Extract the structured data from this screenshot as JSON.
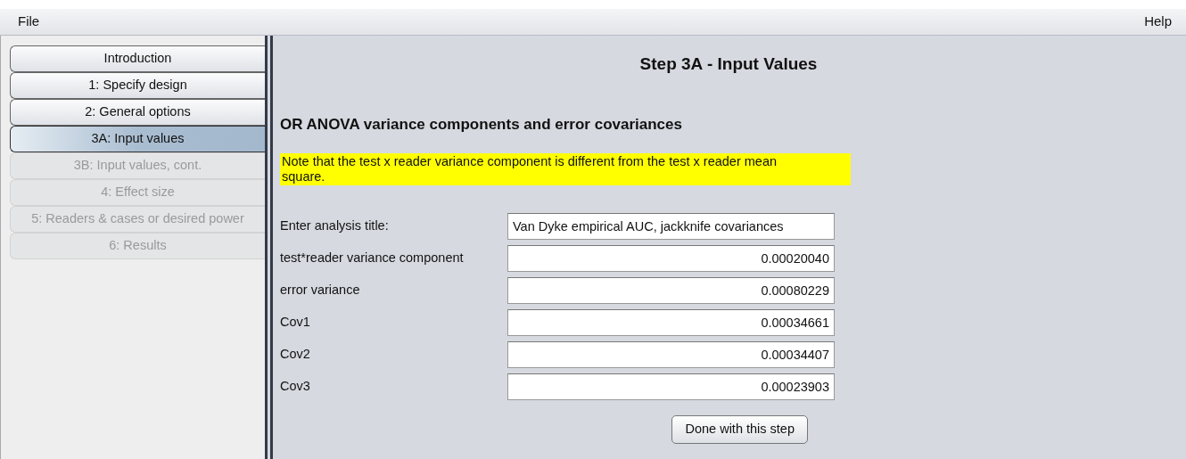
{
  "menu": [
    {
      "label": "File"
    },
    {
      "label": "Help"
    }
  ],
  "steps": [
    {
      "label": "Introduction",
      "selected": false,
      "disabled": false
    },
    {
      "label": "1: Specify design",
      "selected": false,
      "disabled": false
    },
    {
      "label": "2: General options",
      "selected": false,
      "disabled": false
    },
    {
      "label": "3A: Input values",
      "selected": true,
      "disabled": false
    },
    {
      "label": "3B: Input values, cont.",
      "selected": false,
      "disabled": true
    },
    {
      "label": "4: Effect size",
      "selected": false,
      "disabled": true
    },
    {
      "label": "5: Readers & cases or desired power",
      "selected": false,
      "disabled": true
    },
    {
      "label": "6: Results",
      "selected": false,
      "disabled": true
    }
  ],
  "title": "Step 3A - Input Values",
  "section_heading": "OR ANOVA variance components and error covariances",
  "note": "Note that the test x reader variance component is different from the test x reader mean square.",
  "fields": [
    {
      "label": "Enter analysis title:",
      "value": "Van Dyke empirical AUC, jackknife covariances",
      "kind": "text"
    },
    {
      "label": "test*reader variance component",
      "value": "0.00020040",
      "kind": "number"
    },
    {
      "label": "error variance",
      "value": "0.00080229",
      "kind": "number"
    },
    {
      "label": "Cov1",
      "value": "0.00034661",
      "kind": "number"
    },
    {
      "label": "Cov2",
      "value": "0.00034407",
      "kind": "number"
    },
    {
      "label": "Cov3",
      "value": "0.00023903",
      "kind": "number"
    }
  ],
  "done_button": "Done with this step"
}
